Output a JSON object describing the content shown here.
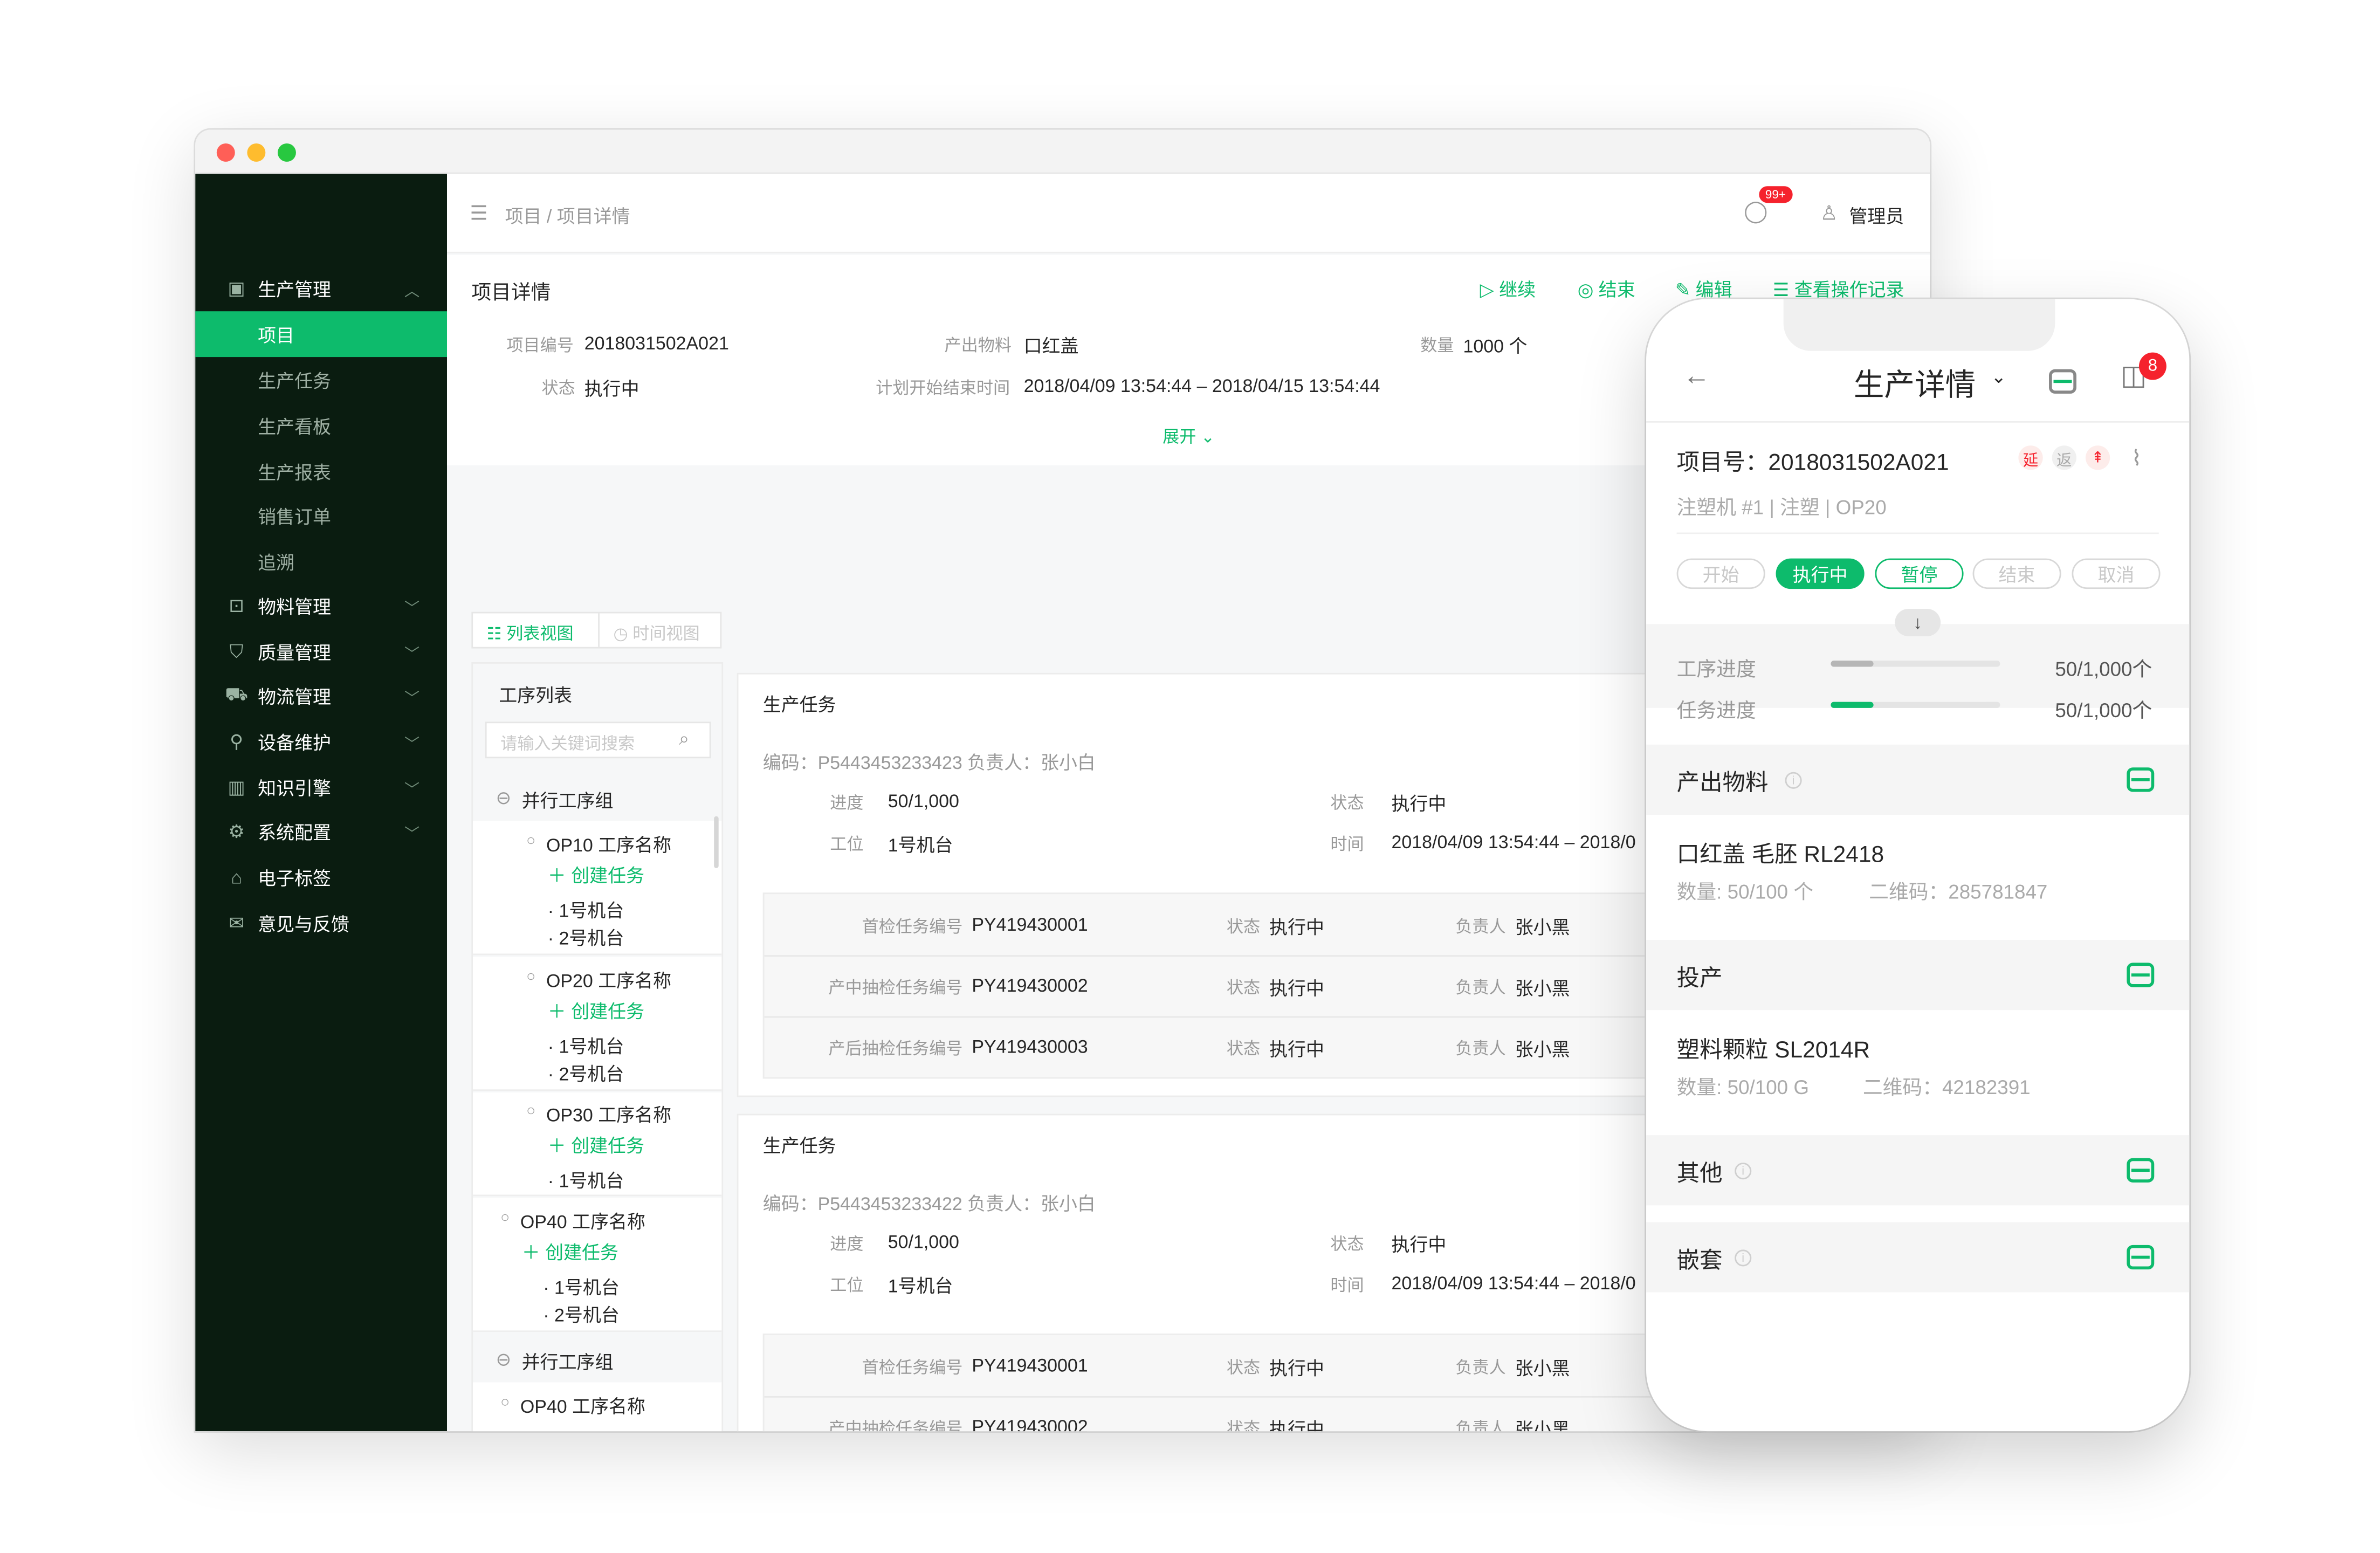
{
  "desktop": {
    "sidebar": {
      "groups": [
        {
          "label": "生产管理",
          "icon": "production-icon"
        },
        {
          "label": "物料管理",
          "icon": "material-icon"
        },
        {
          "label": "质量管理",
          "icon": "shield-icon"
        },
        {
          "label": "物流管理",
          "icon": "truck-icon"
        },
        {
          "label": "设备维护",
          "icon": "wrench-icon"
        },
        {
          "label": "知识引擎",
          "icon": "book-icon"
        },
        {
          "label": "系统配置",
          "icon": "settings-icon"
        },
        {
          "label": "电子标签",
          "icon": "tag-icon"
        },
        {
          "label": "意见与反馈",
          "icon": "mail-icon"
        }
      ],
      "sub_items": [
        "项目",
        "生产任务",
        "生产看板",
        "生产报表",
        "销售订单",
        "追溯"
      ]
    },
    "topbar": {
      "breadcrumb": "项目 / 项目详情",
      "badge": "99+",
      "user": "管理员"
    },
    "detail": {
      "title": "项目详情",
      "actions": {
        "continue": "继续",
        "end": "结束",
        "edit": "编辑",
        "log": "查看操作记录"
      },
      "fields": {
        "project_no_label": "项目编号",
        "project_no": "2018031502A021",
        "output_label": "产出物料",
        "output": "口红盖",
        "qty_label": "数量",
        "qty": "1000 个",
        "status_label": "状态",
        "status": "执行中",
        "plan_label": "计划开始结束时间",
        "plan": "2018/04/09 13:54:44 – 2018/04/15 13:54:44"
      },
      "expand": "展开"
    },
    "view_tabs": {
      "list": "列表视图",
      "time": "时间视图"
    },
    "process": {
      "title": "工序列表",
      "search_placeholder": "请输入关键词搜索",
      "group1": "并行工序组",
      "op10": "OP10 工序名称",
      "op20": "OP20 工序名称",
      "op30": "OP30 工序名称",
      "op40": "OP40 工序名称",
      "group2": "并行工序组",
      "op40b": "OP40 工序名称",
      "op40c": "OP40 工序名称",
      "create": "创建任务",
      "m1": "· 1号机台",
      "m2": "· 2号机台"
    },
    "tasks": [
      {
        "title": "生产任务",
        "code_line": "编码：P5443453233423   负责人：张小白",
        "progress_label": "进度",
        "progress": "50/1,000",
        "status_label": "状态",
        "status": "执行中",
        "station_label": "工位",
        "station": "1号机台",
        "time_label": "时间",
        "time": "2018/04/09 13:54:44 – 2018/0",
        "rows": [
          {
            "label": "首检任务编号",
            "code": "PY419430001",
            "s_label": "状态",
            "s": "执行中",
            "o_label": "负责人",
            "o": "张小黑"
          },
          {
            "label": "产中抽检任务编号",
            "code": "PY419430002",
            "s_label": "状态",
            "s": "执行中",
            "o_label": "负责人",
            "o": "张小黑"
          },
          {
            "label": "产后抽检任务编号",
            "code": "PY419430003",
            "s_label": "状态",
            "s": "执行中",
            "o_label": "负责人",
            "o": "张小黑"
          }
        ]
      },
      {
        "title": "生产任务",
        "code_line": "编码：P5443453233422   负责人：张小白",
        "progress_label": "进度",
        "progress": "50/1,000",
        "status_label": "状态",
        "status": "执行中",
        "station_label": "工位",
        "station": "1号机台",
        "time_label": "时间",
        "time": "2018/04/09 13:54:44 – 2018/0",
        "rows": [
          {
            "label": "首检任务编号",
            "code": "PY419430001",
            "s_label": "状态",
            "s": "执行中",
            "o_label": "负责人",
            "o": "张小黑"
          },
          {
            "label": "产中抽检任务编号",
            "code": "PY419430002",
            "s_label": "状态",
            "s": "执行中",
            "o_label": "负责人",
            "o": "张小黑"
          },
          {
            "label": "产后抽检任务编号",
            "code": "PY419430003",
            "s_label": "状态",
            "s": "执行中",
            "o_label": "负责人",
            "o": "张小黑"
          }
        ]
      }
    ]
  },
  "mobile": {
    "nav_title": "生产详情",
    "cart_badge": "8",
    "project": "项目号：2018031502A021",
    "tags": [
      "延",
      "返",
      "⇞"
    ],
    "machine": "注塑机 #1 | 注塑 | OP20",
    "states": [
      "开始",
      "执行中",
      "暂停",
      "结束",
      "取消"
    ],
    "proc_label": "工序进度",
    "proc_value": "50/1,000个",
    "proc_fraction": 0.25,
    "task_label": "任务进度",
    "task_value": "50/1,000个",
    "task_fraction": 0.25,
    "output_title": "产出物料",
    "output_name": "口红盖 毛胚 RL2418",
    "output_qty": "数量: 50/100 个",
    "output_qr": "二维码：285781847",
    "input_title": "投产",
    "input_name": "塑料颗粒 SL2014R",
    "input_qty": "数量: 50/100 G",
    "input_qr": "二维码：42182391",
    "other_title": "其他",
    "nest_title": "嵌套",
    "colors": {
      "accent": "#0dbb6c",
      "badge": "#f5222d"
    }
  }
}
